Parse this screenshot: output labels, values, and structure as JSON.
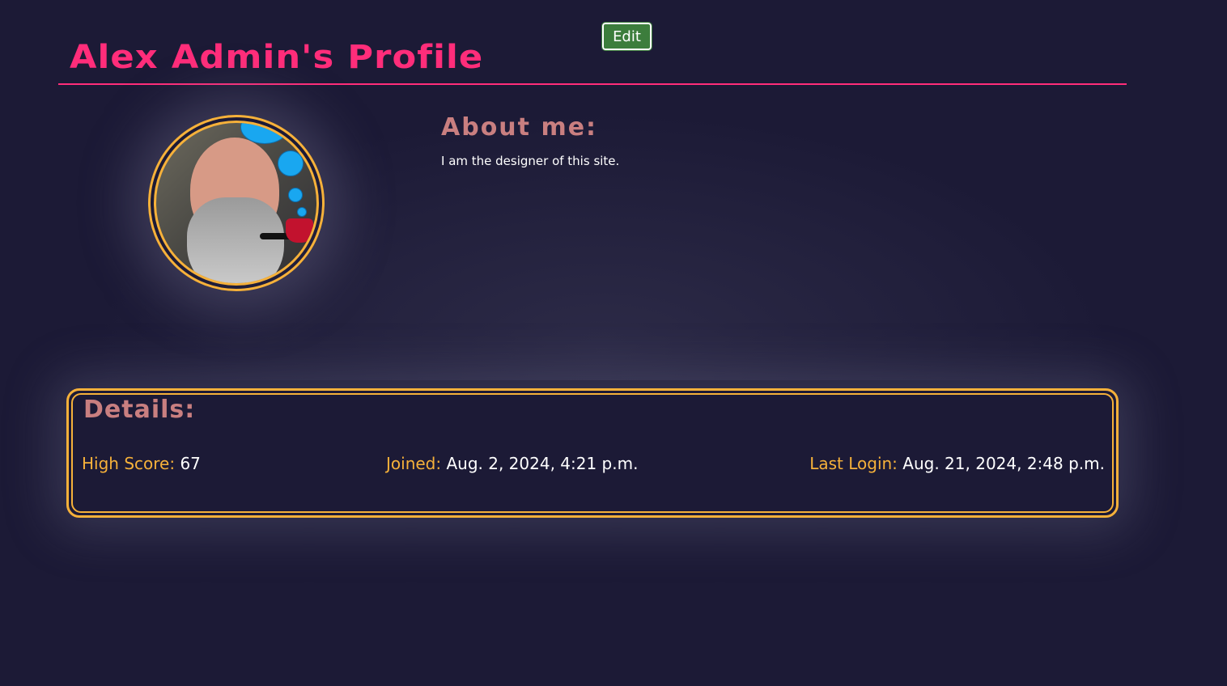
{
  "header": {
    "title": "Alex Admin's Profile",
    "edit_label": "Edit"
  },
  "profile": {
    "avatar_alt": "profile-photo",
    "about_heading": "About me:",
    "about_text": "I am the designer of this site."
  },
  "details": {
    "heading": "Details:",
    "stats": [
      {
        "label": "High Score:",
        "value": "67"
      },
      {
        "label": "Joined:",
        "value": "Aug. 2, 2024, 4:21 p.m."
      },
      {
        "label": "Last Login:",
        "value": "Aug. 21, 2024, 2:48 p.m."
      }
    ]
  },
  "colors": {
    "background": "#1c1a36",
    "title_accent": "#ff2d7a",
    "heading": "#c97f80",
    "gold": "#f6b13a",
    "edit_button": "#3c7d3c"
  }
}
